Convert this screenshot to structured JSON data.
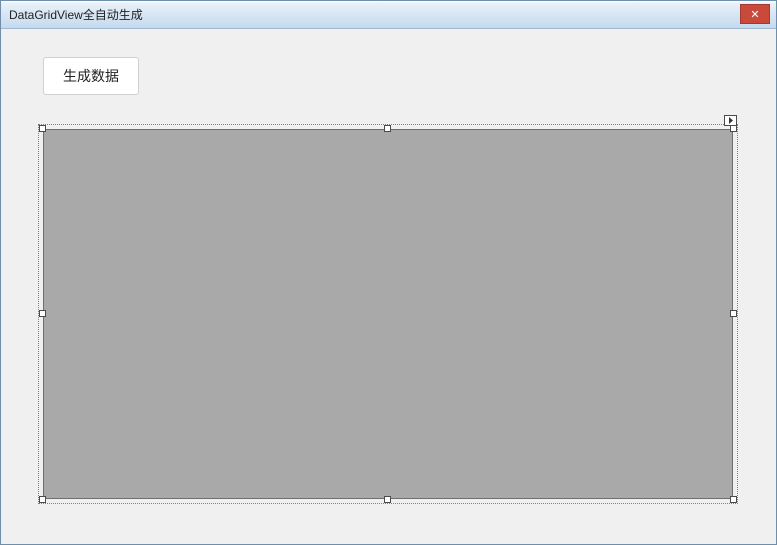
{
  "window": {
    "title": "DataGridView全自动生成",
    "close_glyph": "✕"
  },
  "buttons": {
    "generate_label": "生成数据"
  }
}
